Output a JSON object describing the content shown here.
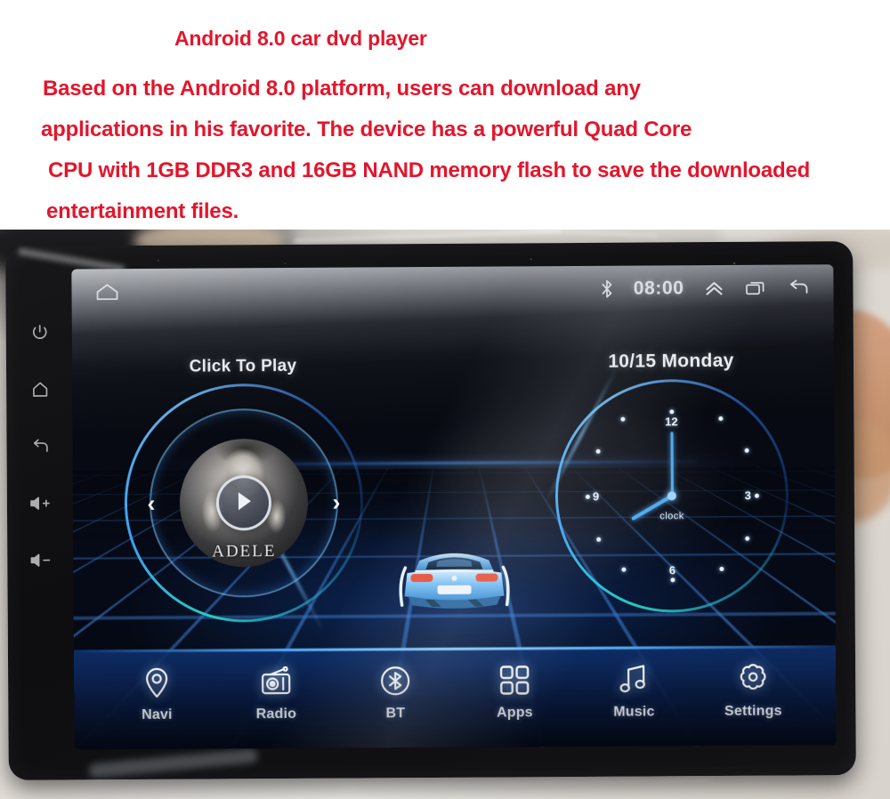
{
  "promo": {
    "title": "Android 8.0 car dvd player",
    "line1": "Based on the Android 8.0 platform, users can download any",
    "line2": "applications in his favorite. The device has a powerful Quad Core",
    "line3": "CPU with 1GB DDR3 and 16GB NAND memory flash to save the downloaded",
    "line4": "entertainment files.",
    "color": "#e2162c"
  },
  "hardware_keys": [
    {
      "name": "power-key",
      "icon": "power-icon"
    },
    {
      "name": "home-key",
      "icon": "home-icon"
    },
    {
      "name": "back-key",
      "icon": "back-arrow-icon"
    },
    {
      "name": "volume-up-key",
      "icon": "volume-up-icon",
      "label": "+"
    },
    {
      "name": "volume-down-key",
      "icon": "volume-down-icon",
      "label": "-"
    }
  ],
  "statusbar": {
    "home_icon": "home-icon",
    "bluetooth_icon": "bluetooth-icon",
    "time": "08:00",
    "expand_icon": "chevron-up-icon",
    "recents_icon": "recents-icon",
    "back_icon": "back-arrow-icon"
  },
  "media_widget": {
    "label": "Click To Play",
    "album_title": "ADELE",
    "play_icon": "play-icon",
    "prev_icon": "chevron-left-icon",
    "next_icon": "chevron-right-icon",
    "prev_glyph": "‹",
    "next_glyph": "›"
  },
  "clock_widget": {
    "date": "10/15 Monday",
    "face_label": "clock",
    "numerals": [
      "12",
      "3",
      "6",
      "9"
    ],
    "hour_hand_deg": 240,
    "minute_hand_deg": 0
  },
  "center_visual": {
    "car_icon": "car-rear-icon",
    "description": "blue sports car on perspective grid"
  },
  "dock": {
    "items": [
      {
        "label": "Navi",
        "icon": "location-pin-icon"
      },
      {
        "label": "Radio",
        "icon": "radio-icon"
      },
      {
        "label": "BT",
        "icon": "bluetooth-circle-icon"
      },
      {
        "label": "Apps",
        "icon": "apps-grid-icon"
      },
      {
        "label": "Music",
        "icon": "music-note-icon"
      },
      {
        "label": "Settings",
        "icon": "gear-icon"
      }
    ]
  },
  "theme": {
    "accent_blue": "#4aa8f0",
    "accent_cyan": "#28dcc8",
    "ui_text": "#f2f5fa",
    "promo_red": "#e2162c"
  }
}
